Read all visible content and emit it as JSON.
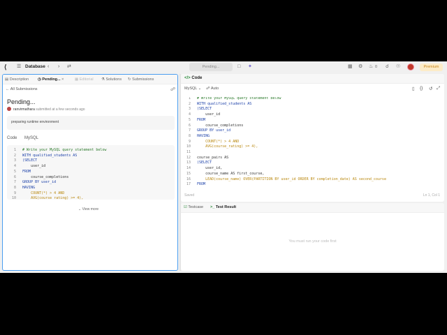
{
  "topnav": {
    "title": "Database",
    "pending_pill": "Pending...",
    "likes": "0",
    "premium": "Premium"
  },
  "left": {
    "tabs": {
      "description": "Description",
      "pending": "Pending...",
      "editorial": "Editorial",
      "solutions": "Solutions",
      "submissions": "Submissions"
    },
    "all_submissions": "All Submissions",
    "status_title": "Pending...",
    "username": "ranvirmathara",
    "submitted_text": "submitted at a few seconds ago",
    "preparing": "preparing runtime environment",
    "code_label": "Code",
    "lang_label": "MySQL",
    "view_more": "View more",
    "code_lines": [
      {
        "n": "1",
        "t": "# Write your MySQL query statement below",
        "c": "cm"
      },
      {
        "n": "2",
        "t": "WITH qualified_students AS",
        "c": "kw"
      },
      {
        "n": "3",
        "t": "(SELECT",
        "c": "kw"
      },
      {
        "n": "4",
        "t": "    user_id",
        "c": ""
      },
      {
        "n": "5",
        "t": "FROM",
        "c": "kw"
      },
      {
        "n": "6",
        "t": "    course_completions",
        "c": ""
      },
      {
        "n": "7",
        "t": "GROUP BY user_id",
        "c": "kw"
      },
      {
        "n": "8",
        "t": "HAVING",
        "c": "kw"
      },
      {
        "n": "9",
        "t": "    COUNT(*) > 4 AND",
        "c": "fn"
      },
      {
        "n": "10",
        "t": "    AVG(course_rating) >= 4),",
        "c": "fn"
      }
    ]
  },
  "right": {
    "header": "Code",
    "lang": "MySQL",
    "auto": "Auto",
    "saved": "Saved",
    "position": "Ln 1, Col 1",
    "code_lines": [
      {
        "n": "1",
        "t": "# Write your MySQL query statement below",
        "c": "cm"
      },
      {
        "n": "2",
        "t": "WITH qualified_students AS",
        "c": "kw"
      },
      {
        "n": "3",
        "t": "(SELECT",
        "c": "kw"
      },
      {
        "n": "4",
        "t": "    user_id",
        "c": ""
      },
      {
        "n": "5",
        "t": "FROM",
        "c": "kw"
      },
      {
        "n": "6",
        "t": "    course_completions",
        "c": ""
      },
      {
        "n": "7",
        "t": "GROUP BY user_id",
        "c": "kw"
      },
      {
        "n": "8",
        "t": "HAVING",
        "c": "kw"
      },
      {
        "n": "9",
        "t": "    COUNT(*) > 4 AND",
        "c": "fn"
      },
      {
        "n": "10",
        "t": "    AVG(course_rating) >= 4),",
        "c": "fn"
      },
      {
        "n": "11",
        "t": "",
        "c": ""
      },
      {
        "n": "12",
        "t": "course_pairs AS",
        "c": ""
      },
      {
        "n": "13",
        "t": "(SELECT",
        "c": "kw"
      },
      {
        "n": "14",
        "t": "    user_id,",
        "c": ""
      },
      {
        "n": "15",
        "t": "    course_name AS first_course,",
        "c": ""
      },
      {
        "n": "16",
        "t": "    LEAD(course_name) OVER(PARTITION BY user_id ORDER BY completion_date) AS second_course",
        "c": "fn"
      },
      {
        "n": "17",
        "t": "FROM",
        "c": "kw"
      }
    ]
  },
  "bottom": {
    "testcase": "Testcase",
    "test_result": "Test Result",
    "empty": "You must run your code first"
  }
}
